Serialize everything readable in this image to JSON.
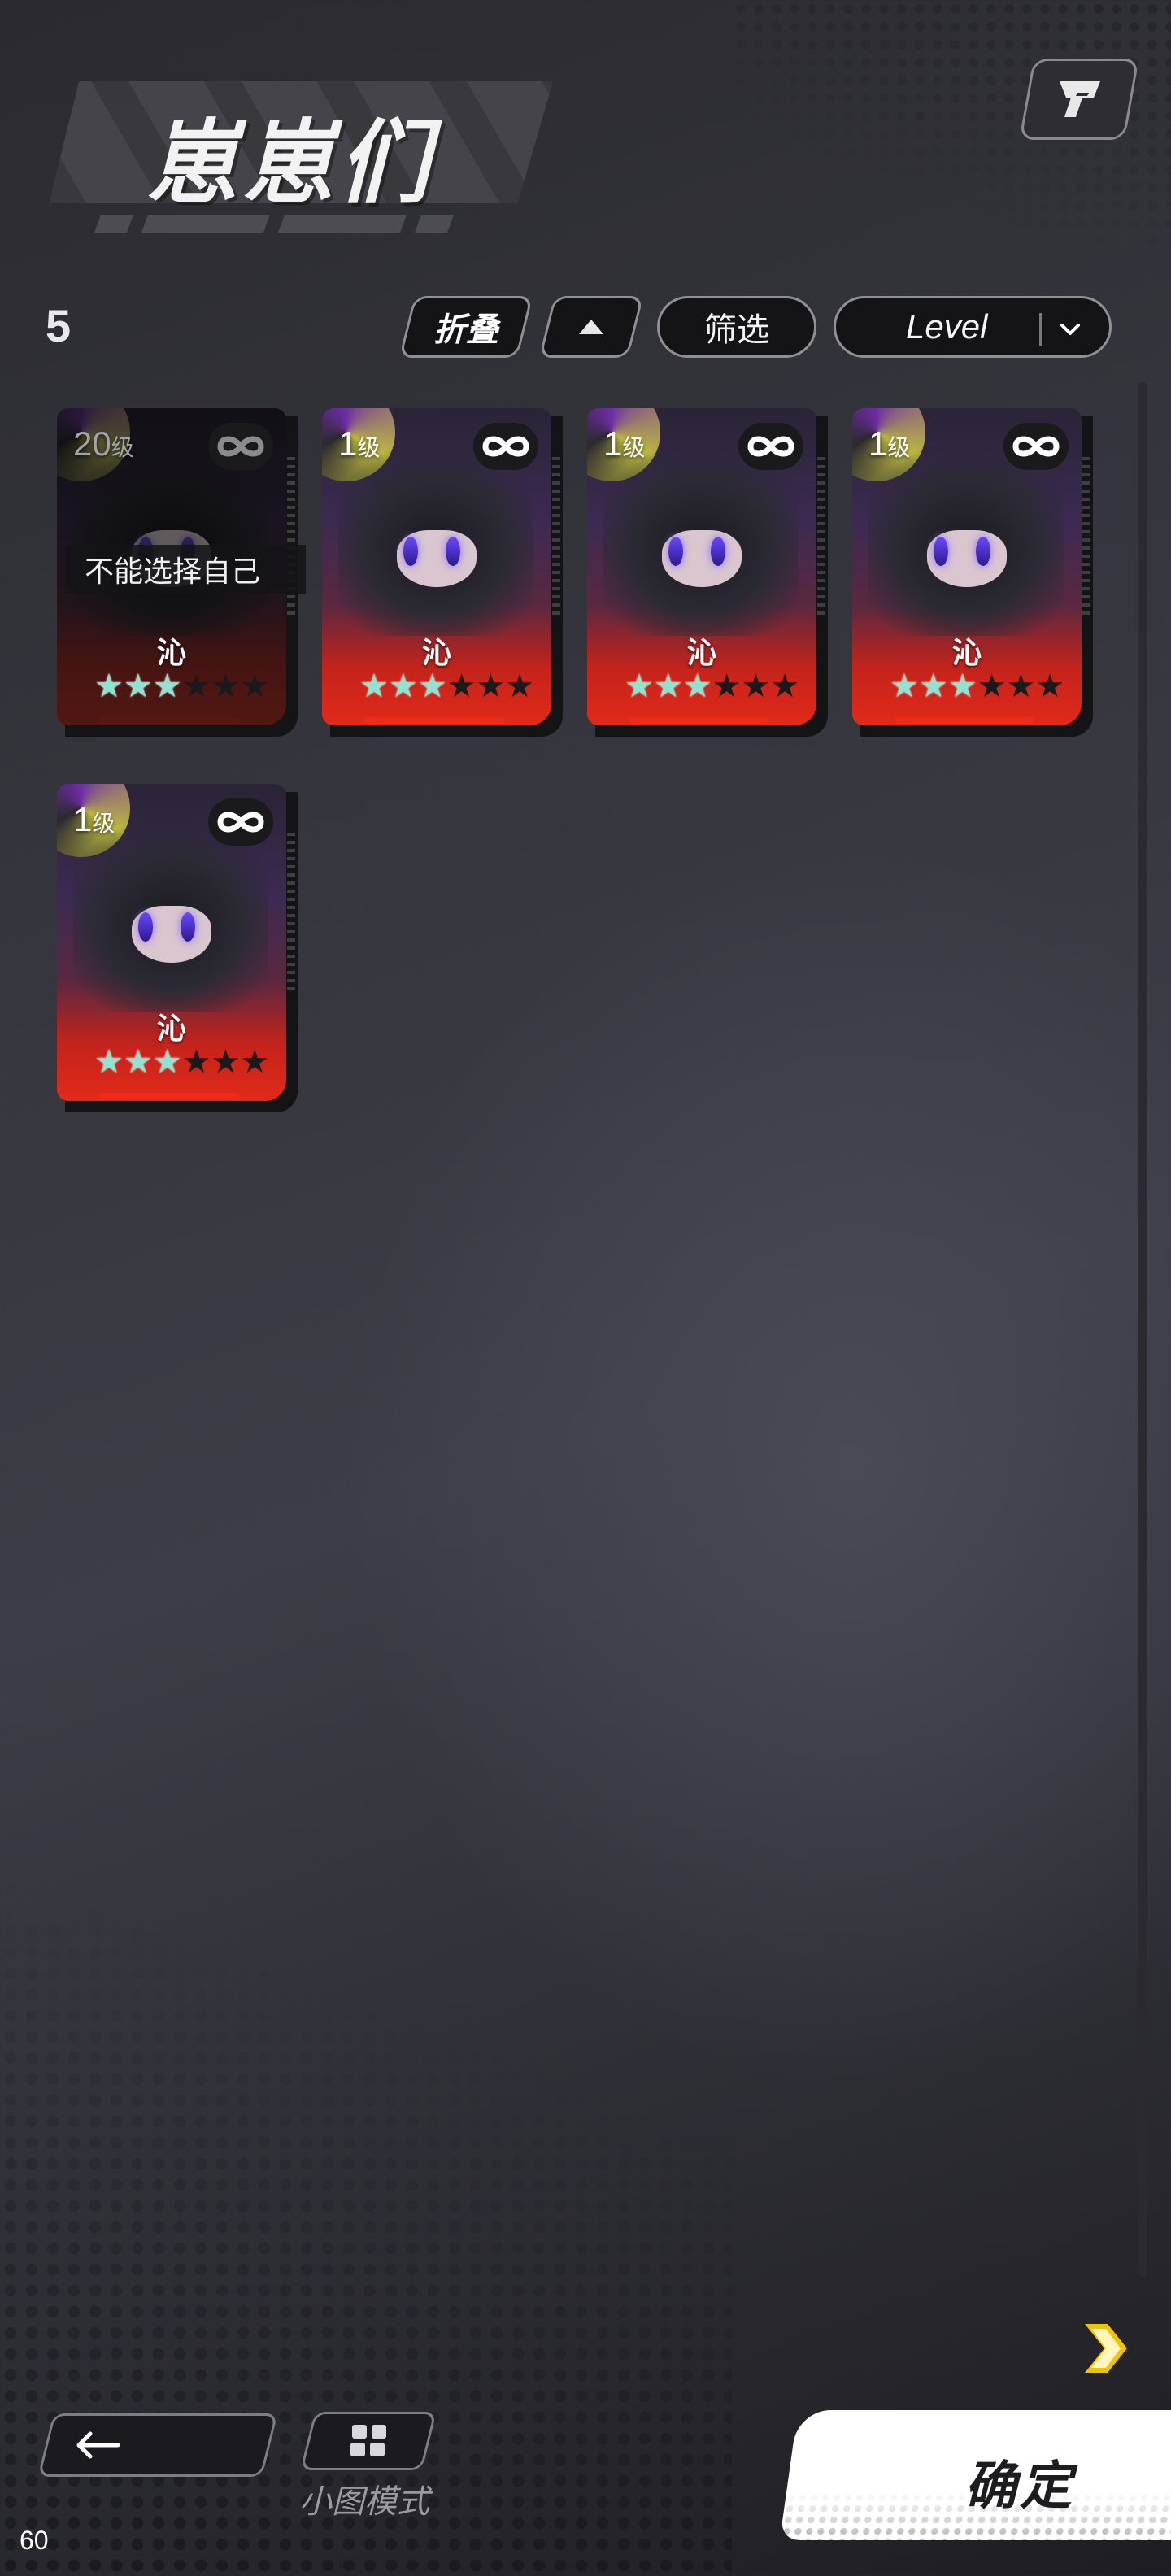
{
  "header": {
    "title": "崽崽们",
    "colors": {
      "background": "#35353d",
      "accent": "#e12a1a",
      "confirm_bg": "#ffffff"
    }
  },
  "toolbar": {
    "count": "5",
    "fold_label": "折叠",
    "sort_icon": "triangle-up-icon",
    "filter_label": "筛选",
    "sort_value": "Level",
    "sort_dropdown_icon": "chevron-down-icon"
  },
  "cards": [
    {
      "level_num": "20",
      "level_unit": "级",
      "name": "沁",
      "stars_on": 3,
      "stars_total": 6,
      "disabled": true,
      "note": "不能选择自己"
    },
    {
      "level_num": "1",
      "level_unit": "级",
      "name": "沁",
      "stars_on": 3,
      "stars_total": 6,
      "disabled": false
    },
    {
      "level_num": "1",
      "level_unit": "级",
      "name": "沁",
      "stars_on": 3,
      "stars_total": 6,
      "disabled": false
    },
    {
      "level_num": "1",
      "level_unit": "级",
      "name": "沁",
      "stars_on": 3,
      "stars_total": 6,
      "disabled": false
    },
    {
      "level_num": "1",
      "level_unit": "级",
      "name": "沁",
      "stars_on": 3,
      "stars_total": 6,
      "disabled": false
    }
  ],
  "bottom": {
    "back_icon": "arrow-left-icon",
    "small_mode_icon": "grid-icon",
    "small_mode_label": "小图模式",
    "confirm_label": "确定",
    "next_icon": "chevron-right-icon",
    "fps": "60"
  }
}
